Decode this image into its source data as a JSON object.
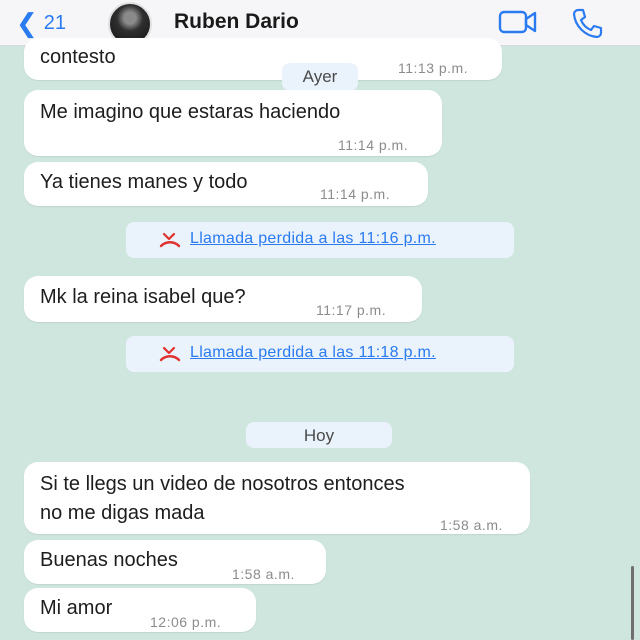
{
  "header": {
    "back_count": "21",
    "contact_name": "Ruben Dario"
  },
  "chat": {
    "messages": [
      {
        "text": "contesto",
        "time": "11:13 p.m."
      },
      {
        "text": "Me imagino que estaras haciendo",
        "time": "11:14 p.m."
      },
      {
        "text": "Ya tienes manes y todo",
        "time": "11:14 p.m."
      },
      {
        "text": "Mk la reina isabel que?",
        "time": "11:17 p.m."
      },
      {
        "text_line1": "Si te llegs un video de nosotros entonces",
        "text_line2": "no me digas mada",
        "time": "1:58 a.m."
      },
      {
        "text": "Buenas noches",
        "time": "1:58 a.m."
      },
      {
        "text": "Mi amor",
        "time": "12:06 p.m."
      }
    ],
    "date_labels": [
      "Ayer",
      "Hoy"
    ],
    "missed_calls": [
      "Llamada perdida a las 11:16 p.m.",
      "Llamada perdida a las 11:18 p.m."
    ]
  },
  "colors": {
    "chat_background": "#cfe6de",
    "bubble": "#ffffff",
    "system_chip": "#eaf2fb",
    "accent_blue": "#2b7bf0",
    "missed_red": "#e0322e"
  },
  "icons": [
    "back-chevron-icon",
    "video-call-icon",
    "phone-icon",
    "missed-call-icon"
  ]
}
